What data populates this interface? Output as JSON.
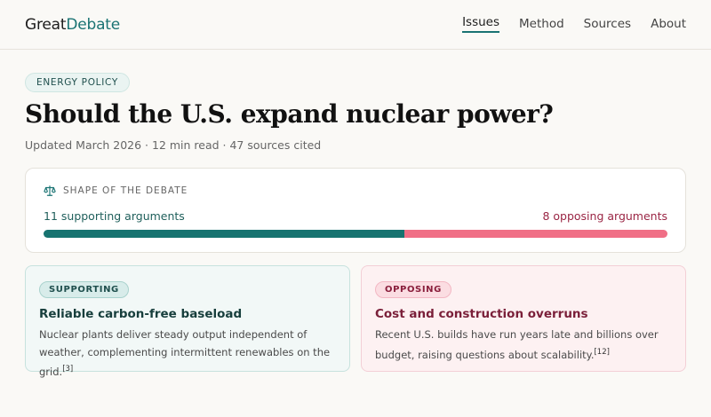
{
  "site": {
    "brand_prefix": "Great",
    "brand_accent": "Debate"
  },
  "nav": {
    "items": [
      {
        "label": "Issues",
        "active": true
      },
      {
        "label": "Method",
        "active": false
      },
      {
        "label": "Sources",
        "active": false
      },
      {
        "label": "About",
        "active": false
      }
    ]
  },
  "article": {
    "tag": "ENERGY POLICY",
    "title": "Should the U.S. expand nuclear power?",
    "meta": "Updated March 2026 · 12 min read · 47 sources cited"
  },
  "shape": {
    "heading": "SHAPE OF THE DEBATE",
    "icon": "scale-icon",
    "supporting_label": "11 supporting arguments",
    "opposing_label": "8 opposing arguments",
    "supporting_count": 11,
    "opposing_count": 8
  },
  "arguments": {
    "supporting": {
      "badge": "SUPPORTING",
      "title": "Reliable carbon-free baseload",
      "body": "Nuclear plants deliver steady output independent of weather, complementing intermittent renewables on the grid.",
      "citation": "[3]"
    },
    "opposing": {
      "badge": "OPPOSING",
      "title": "Cost and construction overruns",
      "body": "Recent U.S. builds have run years late and billions over budget, raising questions about scalability.",
      "citation": "[12]"
    }
  },
  "colors": {
    "accent": "#1a7373",
    "supporting": "#177370",
    "opposing": "#f06f86",
    "opposing_text": "#9a2544"
  }
}
